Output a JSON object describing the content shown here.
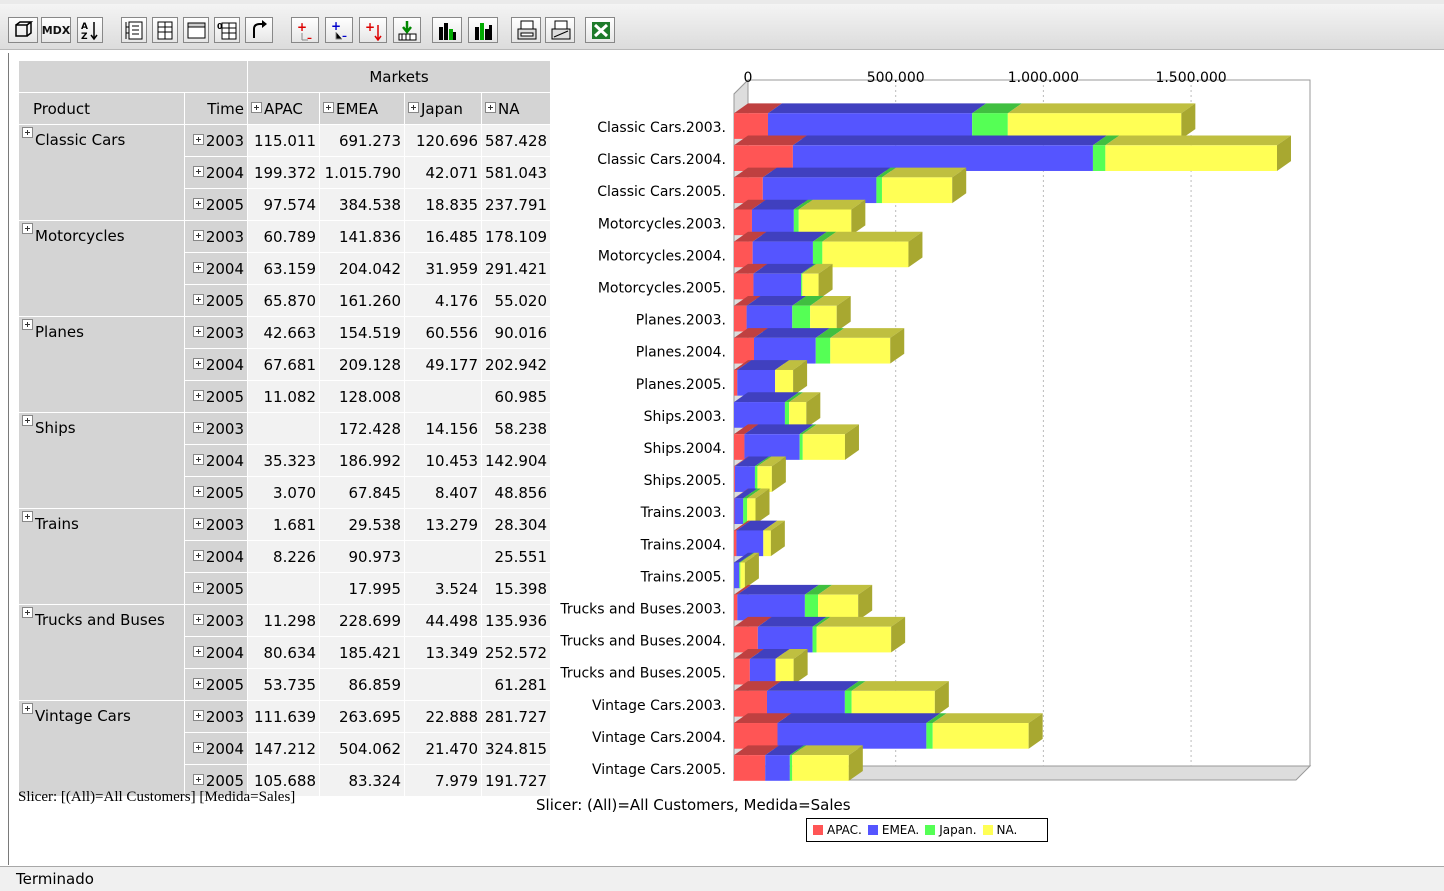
{
  "toolbar": {
    "buttons": [
      {
        "name": "cube-navigator-icon",
        "label": ""
      },
      {
        "name": "mdx-button",
        "label": "MDX"
      },
      {
        "name": "sort-az-icon",
        "label": ""
      },
      {
        "name": "hierarchy-icon",
        "label": ""
      },
      {
        "name": "columns-icon",
        "label": ""
      },
      {
        "name": "empty-rows-icon",
        "label": ""
      },
      {
        "name": "swap-axes-icon",
        "label": ""
      },
      {
        "name": "undo-arrow-icon",
        "label": ""
      },
      {
        "name": "expand-plus-icon",
        "label": ""
      },
      {
        "name": "drill-member-icon",
        "label": ""
      },
      {
        "name": "drill-through-icon",
        "label": ""
      },
      {
        "name": "drill-down-icon",
        "label": ""
      },
      {
        "name": "bar-chart-icon",
        "label": ""
      },
      {
        "name": "chart-config-icon",
        "label": ""
      },
      {
        "name": "print-icon",
        "label": ""
      },
      {
        "name": "print-settings-icon",
        "label": ""
      },
      {
        "name": "excel-export-icon",
        "label": ""
      }
    ]
  },
  "table": {
    "markets_header": "Markets",
    "product_header": "Product",
    "time_header": "Time",
    "columns": [
      "APAC",
      "EMEA",
      "Japan",
      "NA"
    ],
    "groups": [
      {
        "product": "Classic Cars",
        "rows": [
          {
            "year": "2003",
            "values": [
              "115.011",
              "691.273",
              "120.696",
              "587.428"
            ]
          },
          {
            "year": "2004",
            "values": [
              "199.372",
              "1.015.790",
              "42.071",
              "581.043"
            ]
          },
          {
            "year": "2005",
            "values": [
              "97.574",
              "384.538",
              "18.835",
              "237.791"
            ]
          }
        ]
      },
      {
        "product": "Motorcycles",
        "rows": [
          {
            "year": "2003",
            "values": [
              "60.789",
              "141.836",
              "16.485",
              "178.109"
            ]
          },
          {
            "year": "2004",
            "values": [
              "63.159",
              "204.042",
              "31.959",
              "291.421"
            ]
          },
          {
            "year": "2005",
            "values": [
              "65.870",
              "161.260",
              "4.176",
              "55.020"
            ]
          }
        ]
      },
      {
        "product": "Planes",
        "rows": [
          {
            "year": "2003",
            "values": [
              "42.663",
              "154.519",
              "60.556",
              "90.016"
            ]
          },
          {
            "year": "2004",
            "values": [
              "67.681",
              "209.128",
              "49.177",
              "202.942"
            ]
          },
          {
            "year": "2005",
            "values": [
              "11.082",
              "128.008",
              "",
              "60.985"
            ]
          }
        ]
      },
      {
        "product": "Ships",
        "rows": [
          {
            "year": "2003",
            "values": [
              "",
              "172.428",
              "14.156",
              "58.238"
            ]
          },
          {
            "year": "2004",
            "values": [
              "35.323",
              "186.992",
              "10.453",
              "142.904"
            ]
          },
          {
            "year": "2005",
            "values": [
              "3.070",
              "67.845",
              "8.407",
              "48.856"
            ]
          }
        ]
      },
      {
        "product": "Trains",
        "rows": [
          {
            "year": "2003",
            "values": [
              "1.681",
              "29.538",
              "13.279",
              "28.304"
            ]
          },
          {
            "year": "2004",
            "values": [
              "8.226",
              "90.973",
              "",
              "25.551"
            ]
          },
          {
            "year": "2005",
            "values": [
              "",
              "17.995",
              "3.524",
              "15.398"
            ]
          }
        ]
      },
      {
        "product": "Trucks and Buses",
        "rows": [
          {
            "year": "2003",
            "values": [
              "11.298",
              "228.699",
              "44.498",
              "135.936"
            ]
          },
          {
            "year": "2004",
            "values": [
              "80.634",
              "185.421",
              "13.349",
              "252.572"
            ]
          },
          {
            "year": "2005",
            "values": [
              "53.735",
              "86.859",
              "",
              "61.281"
            ]
          }
        ]
      },
      {
        "product": "Vintage Cars",
        "rows": [
          {
            "year": "2003",
            "values": [
              "111.639",
              "263.695",
              "22.888",
              "281.727"
            ]
          },
          {
            "year": "2004",
            "values": [
              "147.212",
              "504.062",
              "21.470",
              "324.815"
            ]
          },
          {
            "year": "2005",
            "values": [
              "105.688",
              "83.324",
              "7.979",
              "191.727"
            ]
          }
        ]
      }
    ],
    "slicer": "Slicer: [(All)=All Customers] [Medida=Sales]"
  },
  "chart_data": {
    "type": "bar",
    "orientation": "horizontal",
    "stacked": true,
    "categories": [
      "Classic Cars.2003.",
      "Classic Cars.2004.",
      "Classic Cars.2005.",
      "Motorcycles.2003.",
      "Motorcycles.2004.",
      "Motorcycles.2005.",
      "Planes.2003.",
      "Planes.2004.",
      "Planes.2005.",
      "Ships.2003.",
      "Ships.2004.",
      "Ships.2005.",
      "Trains.2003.",
      "Trains.2004.",
      "Trains.2005.",
      "Trucks and Buses.2003.",
      "Trucks and Buses.2004.",
      "Trucks and Buses.2005.",
      "Vintage Cars.2003.",
      "Vintage Cars.2004.",
      "Vintage Cars.2005."
    ],
    "series": [
      {
        "name": "APAC.",
        "color": "#ff5555",
        "values": [
          115011,
          199372,
          97574,
          60789,
          63159,
          65870,
          42663,
          67681,
          11082,
          0,
          35323,
          3070,
          1681,
          8226,
          0,
          11298,
          80634,
          53735,
          111639,
          147212,
          105688
        ]
      },
      {
        "name": "EMEA.",
        "color": "#5555ff",
        "values": [
          691273,
          1015790,
          384538,
          141836,
          204042,
          161260,
          154519,
          209128,
          128008,
          172428,
          186992,
          67845,
          29538,
          90973,
          17995,
          228699,
          185421,
          86859,
          263695,
          504062,
          83324
        ]
      },
      {
        "name": "Japan.",
        "color": "#55ff55",
        "values": [
          120696,
          42071,
          18835,
          16485,
          31959,
          4176,
          60556,
          49177,
          0,
          14156,
          10453,
          8407,
          13279,
          0,
          3524,
          44498,
          13349,
          0,
          22888,
          21470,
          7979
        ]
      },
      {
        "name": "NA.",
        "color": "#ffff55",
        "values": [
          587428,
          581043,
          237791,
          178109,
          291421,
          55020,
          90016,
          202942,
          60985,
          58238,
          142904,
          48856,
          28304,
          25551,
          15398,
          135936,
          252572,
          61281,
          281727,
          324815,
          191727
        ]
      }
    ],
    "x_ticks": [
      "0",
      "500.000",
      "1.000.000",
      "1.500.000"
    ],
    "x_tick_values": [
      0,
      500000,
      1000000,
      1500000
    ],
    "xlim": [
      0,
      1950000
    ],
    "legend_position": "bottom",
    "slicer": "Slicer: (All)=All Customers, Medida=Sales"
  },
  "status": {
    "text": "Terminado"
  }
}
